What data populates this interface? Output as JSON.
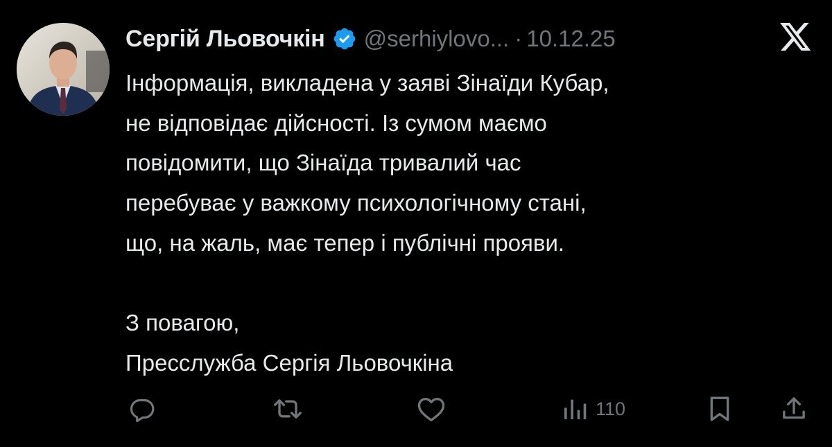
{
  "author": {
    "display_name": "Сергій Льовочкін",
    "handle": "@serhiylovo...",
    "separator": "·",
    "date": "10.12.25",
    "verified": true,
    "avatar_icon": "profile-photo"
  },
  "platform_icon": "x-logo-icon",
  "tweet": {
    "lines": [
      "Інформація, викладена у заяві Зінаїди Кубар,",
      "не відповідає дійсності.  Із сумом маємо",
      "повідомити, що Зінаїда тривалий час",
      "перебуває у важкому психологічному стані,",
      "що, на жаль, має тепер і публічні прояви."
    ],
    "closing_lines": [
      "З повагою,",
      "Пресслужба Сергія Льовочкіна"
    ]
  },
  "actions": {
    "reply_icon": "reply-icon",
    "retweet_icon": "retweet-icon",
    "like_icon": "heart-icon",
    "views_icon": "views-chart-icon",
    "views_count": "110",
    "bookmark_icon": "bookmark-icon",
    "share_icon": "share-icon"
  },
  "colors": {
    "background": "#000000",
    "text_primary": "#e7e9ea",
    "text_secondary": "#71767b",
    "verified_blue": "#1d9bf0"
  }
}
